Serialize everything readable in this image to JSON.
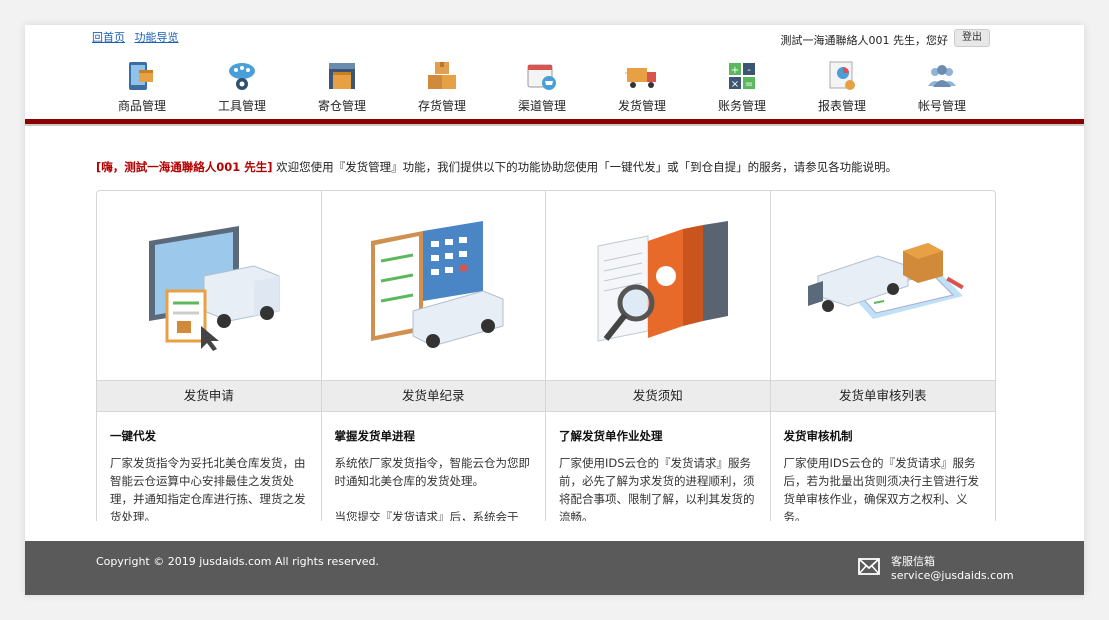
{
  "header": {
    "links": [
      "回首页",
      "功能导览"
    ],
    "user_greeting": "測試一海通聯絡人001 先生，您好",
    "logout_label": "登出"
  },
  "nav": {
    "items": [
      {
        "label": "商品管理",
        "icon": "product-tablet-icon"
      },
      {
        "label": "工具管理",
        "icon": "cloud-gear-icon"
      },
      {
        "label": "寄仓管理",
        "icon": "warehouse-icon"
      },
      {
        "label": "存货管理",
        "icon": "boxes-icon"
      },
      {
        "label": "渠道管理",
        "icon": "calendar-cart-icon"
      },
      {
        "label": "发货管理",
        "icon": "delivery-truck-icon"
      },
      {
        "label": "账务管理",
        "icon": "calculator-icon"
      },
      {
        "label": "报表管理",
        "icon": "report-chart-icon"
      },
      {
        "label": "帐号管理",
        "icon": "users-icon"
      }
    ]
  },
  "welcome": {
    "highlight": "[嗨，测試一海通聯絡人001 先生]",
    "text": " 欢迎您使用『发货管理』功能，我们提供以下的功能协助您使用「一键代发」或「到仓自提」的服务，请参见各功能说明。"
  },
  "cards": [
    {
      "title": "发货申请",
      "subtitle": "一键代发",
      "desc": "厂家发货指令为妥托北美仓库发货，由智能云仓运算中心安排最佳之发货处理，并通知指定仓库进行拣、理货之发货处理。",
      "image": "truck-screen-illustration"
    },
    {
      "title": "发货单纪录",
      "subtitle": "掌握发货单进程",
      "desc": "系统依厂家发货指令，智能云仓为您即时通知北美仓库的发货处理。\n\n当您提交『发货请求』后，系统会于",
      "image": "checklist-truck-illustration"
    },
    {
      "title": "发货须知",
      "subtitle": "了解发货单作业处理",
      "desc": "厂家使用IDS云仓的『发货请求』服务前，必先了解为求发货的进程顺利，须将配合事项、限制了解，以利其发货的流畅。",
      "image": "binders-magnifier-illustration"
    },
    {
      "title": "发货单审核列表",
      "subtitle": "发货审核机制",
      "desc": "厂家使用IDS云仓的『发货请求』服务后，若为批量出货则须决行主管进行发货单审核作业，确保双方之权利、义务。",
      "image": "truck-clipboard-illustration"
    }
  ],
  "footer": {
    "copyright": "Copyright © 2019 jusdaids.com All rights reserved.",
    "service_label": "客服信箱",
    "service_email": "service@jusdaids.com"
  },
  "colors": {
    "accent_red": "#8b0000",
    "footer_bg": "#5a5a5a",
    "highlight_red": "#b30000"
  }
}
